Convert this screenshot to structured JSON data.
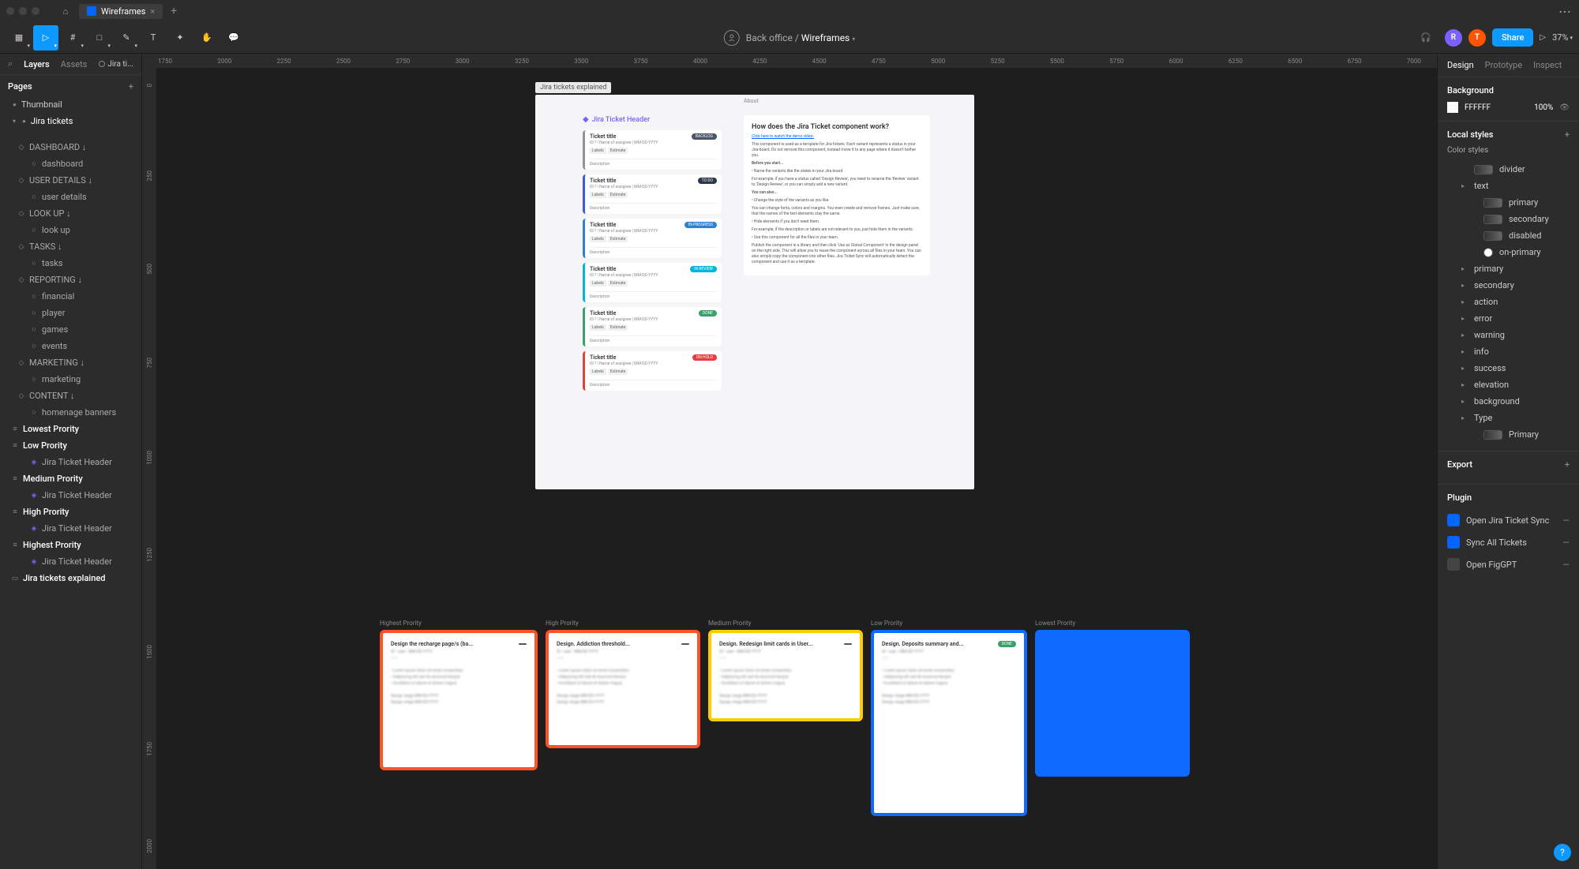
{
  "tab": {
    "filename": "Wireframes"
  },
  "toolbar": {
    "breadcrumb_root": "Back office",
    "breadcrumb_file": "Wireframes",
    "share": "Share",
    "users": [
      "R",
      "T"
    ],
    "zoom": "37%"
  },
  "left": {
    "tab_layers": "Layers",
    "tab_assets": "Assets",
    "page_chip": "Jira ti...",
    "pages_label": "Pages",
    "pages": [
      {
        "label": "Thumbnail",
        "active": false
      },
      {
        "label": "Jira tickets",
        "active": true
      }
    ],
    "layers": [
      {
        "label": "DASHBOARD ↓",
        "ico": "◇",
        "d": 1
      },
      {
        "label": "dashboard",
        "ico": "○",
        "d": 2
      },
      {
        "label": "USER DETAILS ↓",
        "ico": "◇",
        "d": 1
      },
      {
        "label": "user details",
        "ico": "○",
        "d": 2
      },
      {
        "label": "LOOK UP ↓",
        "ico": "◇",
        "d": 1
      },
      {
        "label": "look up",
        "ico": "○",
        "d": 2
      },
      {
        "label": "TASKS ↓",
        "ico": "◇",
        "d": 1
      },
      {
        "label": "tasks",
        "ico": "○",
        "d": 2
      },
      {
        "label": "REPORTING ↓",
        "ico": "◇",
        "d": 1
      },
      {
        "label": "financial",
        "ico": "○",
        "d": 2
      },
      {
        "label": "player",
        "ico": "○",
        "d": 2
      },
      {
        "label": "games",
        "ico": "○",
        "d": 2
      },
      {
        "label": "events",
        "ico": "○",
        "d": 2
      },
      {
        "label": "MARKETING ↓",
        "ico": "◇",
        "d": 1
      },
      {
        "label": "marketing",
        "ico": "○",
        "d": 2
      },
      {
        "label": "CONTENT ↓",
        "ico": "◇",
        "d": 1
      },
      {
        "label": "homenage banners",
        "ico": "○",
        "d": 2
      },
      {
        "label": "Lowest Prority",
        "ico": "≡",
        "d": 0,
        "bold": true
      },
      {
        "label": "Low Prority",
        "ico": "≡",
        "d": 0,
        "bold": true
      },
      {
        "label": "Jira Ticket Header",
        "ico": "◈",
        "d": 2,
        "diamond": true
      },
      {
        "label": "Medium Prority",
        "ico": "≡",
        "d": 0,
        "bold": true
      },
      {
        "label": "Jira Ticket Header",
        "ico": "◈",
        "d": 2,
        "diamond": true
      },
      {
        "label": "High Prority",
        "ico": "≡",
        "d": 0,
        "bold": true
      },
      {
        "label": "Jira Ticket Header",
        "ico": "◈",
        "d": 2,
        "diamond": true
      },
      {
        "label": "Highest Prority",
        "ico": "≡",
        "d": 0,
        "bold": true
      },
      {
        "label": "Jira Ticket Header",
        "ico": "◈",
        "d": 2,
        "diamond": true
      },
      {
        "label": "Jira tickets explained",
        "ico": "▭",
        "d": 0,
        "bold": true
      }
    ]
  },
  "ruler_h": [
    "1750",
    "2000",
    "2250",
    "2500",
    "2750",
    "3000",
    "3250",
    "3500",
    "3750",
    "4000",
    "4250",
    "4500",
    "4750",
    "5000",
    "5250",
    "5500",
    "5750",
    "6000",
    "6250",
    "6500",
    "6750",
    "7000"
  ],
  "ruler_v": [
    "0",
    "250",
    "500",
    "750",
    "1000",
    "1250",
    "1500",
    "1750",
    "2000"
  ],
  "canvas": {
    "explained_label": "Jira tickets explained",
    "component_header": "Jira Ticket Header",
    "tickets": [
      {
        "title": "Ticket title",
        "badge": "BACKLOG",
        "color": "#4a5568",
        "border": "#949494"
      },
      {
        "title": "Ticket title",
        "badge": "TO DO",
        "color": "#2d3748",
        "border": "#3b5bdb"
      },
      {
        "title": "Ticket title",
        "badge": "IN PROGRESS",
        "color": "#3182ce",
        "border": "#3182ce"
      },
      {
        "title": "Ticket title",
        "badge": "IN REVIEW",
        "color": "#00b5d8",
        "border": "#00b5d8"
      },
      {
        "title": "Ticket title",
        "badge": "DONE",
        "color": "#38a169",
        "border": "#38a169"
      },
      {
        "title": "Ticket title",
        "badge": "ON HOLD",
        "color": "#e53e3e",
        "border": "#e53e3e"
      }
    ],
    "ticket_meta": "ID-? | Name of assignee | MM-DD-YYYY",
    "ticket_labels": [
      "Labels",
      "Estimate"
    ],
    "ticket_desc": "Description",
    "about_label": "About",
    "about_title": "How does the Jira Ticket component work?",
    "about_link": "Click here to watch the demo video.",
    "about_p1": "This component is used as a template for Jira tickets. Each variant represents a status in your Jira-board. Do not remove this component, instead move it to any page where it doesn't bother you.",
    "about_sub1": "Before you start...",
    "about_b1": "• Name the variants like the states in your Jira board.",
    "about_b1d": "For example, if you have a status called 'Design Review', you need to rename the 'Review' variant to 'Design Review', or you can simply add a new variant.",
    "about_sub2": "You can also...",
    "about_b2": "• Change the style of the variants as you like.",
    "about_b2d": "You can change fonts, colors and margins. You even create and remove frames. Just make sure, that the names of the text elements stay the same.",
    "about_b3": "• Hide elements if you don't need them.",
    "about_b3d": "For example, if the description or labels are not relevant to you, just hide them in the variants.",
    "about_b4": "• Use this component for all the files in your team.",
    "about_b4d": "Publish the component in a library and then click 'Use as Global Component' in the design panel on the right side. This will allow you to reuse the component across all files in your team. You can also simply copy the component into other files. Jira Ticket Sync will automatically detect the component and use it as a template.",
    "priorities": [
      {
        "label": "Highest Prority",
        "cls": "p1",
        "title": "Design the recharge page/s (ba...",
        "badge": "",
        "bcolor": "#555"
      },
      {
        "label": "High Prority",
        "cls": "p2",
        "title": "Design. Addiction threshold...",
        "badge": "",
        "bcolor": "#555"
      },
      {
        "label": "Medium Prority",
        "cls": "p3",
        "title": "Design. Redesign limit cards in User...",
        "badge": "",
        "bcolor": "#555"
      },
      {
        "label": "Low Prority",
        "cls": "p4",
        "title": "Design. Deposits summary and...",
        "badge": "DONE",
        "bcolor": "#38a169"
      },
      {
        "label": "Lowest Prority",
        "cls": "p5",
        "title": "",
        "badge": "",
        "bcolor": ""
      }
    ]
  },
  "right": {
    "tab_design": "Design",
    "tab_prototype": "Prototype",
    "tab_inspect": "Inspect",
    "bg_title": "Background",
    "bg_hex": "FFFFFF",
    "bg_opacity": "100%",
    "local_styles": "Local styles",
    "color_styles": "Color styles",
    "styles": [
      {
        "label": "divider",
        "indent": 1,
        "sw": true
      },
      {
        "label": "text",
        "indent": 1,
        "expand": true
      },
      {
        "label": "primary",
        "indent": 2,
        "sw": true
      },
      {
        "label": "secondary",
        "indent": 2,
        "sw": true
      },
      {
        "label": "disabled",
        "indent": 2,
        "sw": true
      },
      {
        "label": "on-primary",
        "indent": 2,
        "circle": true
      },
      {
        "label": "primary",
        "indent": 1,
        "expand": true
      },
      {
        "label": "secondary",
        "indent": 1,
        "expand": true
      },
      {
        "label": "action",
        "indent": 1,
        "expand": true
      },
      {
        "label": "error",
        "indent": 1,
        "expand": true
      },
      {
        "label": "warning",
        "indent": 1,
        "expand": true
      },
      {
        "label": "info",
        "indent": 1,
        "expand": true
      },
      {
        "label": "success",
        "indent": 1,
        "expand": true
      },
      {
        "label": "elevation",
        "indent": 1,
        "expand": true
      },
      {
        "label": "background",
        "indent": 1,
        "expand": true
      },
      {
        "label": "Type",
        "indent": 1,
        "expand": true
      },
      {
        "label": "Primary",
        "indent": 2,
        "sw": true
      }
    ],
    "export": "Export",
    "plugin": "Plugin",
    "plugins": [
      {
        "label": "Open Jira Ticket Sync",
        "blue": true
      },
      {
        "label": "Sync All Tickets",
        "blue": true
      },
      {
        "label": "Open FigGPT",
        "blue": false
      }
    ]
  }
}
